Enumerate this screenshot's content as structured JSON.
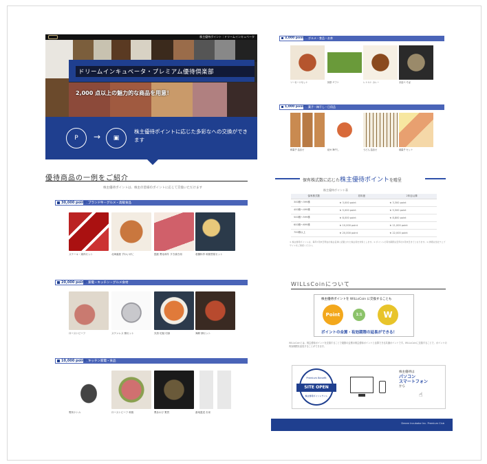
{
  "hero": {
    "header_text": "株主優待ポイント｜ドリームインキュベータ",
    "title": "ドリームインキュベータ・プレミアム優待倶楽部",
    "subtitle": "2,000 点以上の魅力的な商品を用意！",
    "band_text": "株主優待ポイントに応じた多彩なへの交換ができます"
  },
  "intro": {
    "heading": "優待商品の一例をご紹介",
    "desc": "株主優待ポイントは、株主の皆様のポイントに応じて交換いただけます"
  },
  "tiers_left": [
    {
      "points": "30,000 point〜",
      "desc": "ブランド牛・グルメ・高級食品",
      "items": [
        {
          "caption": "ステーキ・焼肉セット"
        },
        {
          "caption": "北海道産 ずわいがに"
        },
        {
          "caption": "国産 黒毛和牛 すき焼き用"
        },
        {
          "caption": "老舗料亭 和風惣菜セット"
        }
      ]
    },
    {
      "points": "20,000 point〜",
      "desc": "家電・キッチン・グルメ食材",
      "items": [
        {
          "caption": "ローストビーフ"
        },
        {
          "caption": "ステンレス 鍋セット"
        },
        {
          "caption": "天然 紅鮭 切身"
        },
        {
          "caption": "海鮮 鍋セット"
        }
      ]
    },
    {
      "points": "10,000 point〜",
      "desc": "キッチン家電・食品",
      "items": [
        {
          "caption": "電気ケトル"
        },
        {
          "caption": "ローストビーフ 和風"
        },
        {
          "caption": "黒あわび 煮貝"
        },
        {
          "caption": "産地直送 お米"
        }
      ]
    }
  ],
  "tiers_right": [
    {
      "points": "3,000 point〜",
      "desc": "グルメ・食品・お茶",
      "items": [
        {
          "caption": "ソーセージセット"
        },
        {
          "caption": "抹茶 ギフト"
        },
        {
          "caption": "レトルト カレー"
        },
        {
          "caption": "手延べ そば"
        }
      ]
    },
    {
      "points": "1,000 point〜",
      "desc": "菓子・梅干し・日用品",
      "items": [
        {
          "caption": "和菓子 詰合せ"
        },
        {
          "caption": "紀州 梅干し"
        },
        {
          "caption": "うどん 詰合せ"
        },
        {
          "caption": "焼菓子 セット"
        }
      ]
    }
  ],
  "points_section": {
    "heading_pre": "保有株式数に応じた",
    "heading_highlight": "株主優待ポイント",
    "heading_post": "を贈呈",
    "table_caption": "株主優待ポイント表",
    "columns": [
      "保有株式数",
      "初年度",
      "2年目以降"
    ],
    "rows": [
      [
        "300株〜399株",
        "★ 3,000 point",
        "★ 3,300 point"
      ],
      [
        "400株〜499株",
        "★ 5,000 point",
        "★ 5,500 point"
      ],
      [
        "500株〜599株",
        "★ 8,000 point",
        "★ 8,800 point"
      ],
      [
        "600株〜699株",
        "★ 10,000 point",
        "★ 11,000 point"
      ],
      [
        "700株以上",
        "★ 20,000 point",
        "★ 22,000 point"
      ]
    ],
    "notes": "※ 株主優待ポイントは、毎年3月末日現在の株主名簿に記載された株主様を対象とします。※ ポイントの有効期限は翌年の6月末日までとなります。※ 詳細は当社ウェブサイトをご確認ください。"
  },
  "wills": {
    "heading": "WILLsCoinについて",
    "box_top": "株主優待ポイントを WILLsCoin に交換することも",
    "box_bottom": "ポイントの合算・有効期限の延長ができる！",
    "coin_left": "Point",
    "coin_mid": "1:1",
    "coin_right": "W",
    "text": "WILLsCoinとは、株主優待ポイントを交換することで複数の企業の株主優待ポイントと合算できる共通ポイントです。WILLsCoinに交換することで、ポイントの有効期限を延長することができます。"
  },
  "site": {
    "badge_top": "Premium Benefit",
    "badge_ribbon": "SITE OPEN",
    "badge_bottom": "株主優待ポイントサイト",
    "dev_line1": "株主優待は",
    "dev_line2": "パソコン",
    "dev_line3": "スマートフォン",
    "dev_line4": "から"
  },
  "footer": {
    "text": "Dream Incubator Inc. Premium Club"
  }
}
